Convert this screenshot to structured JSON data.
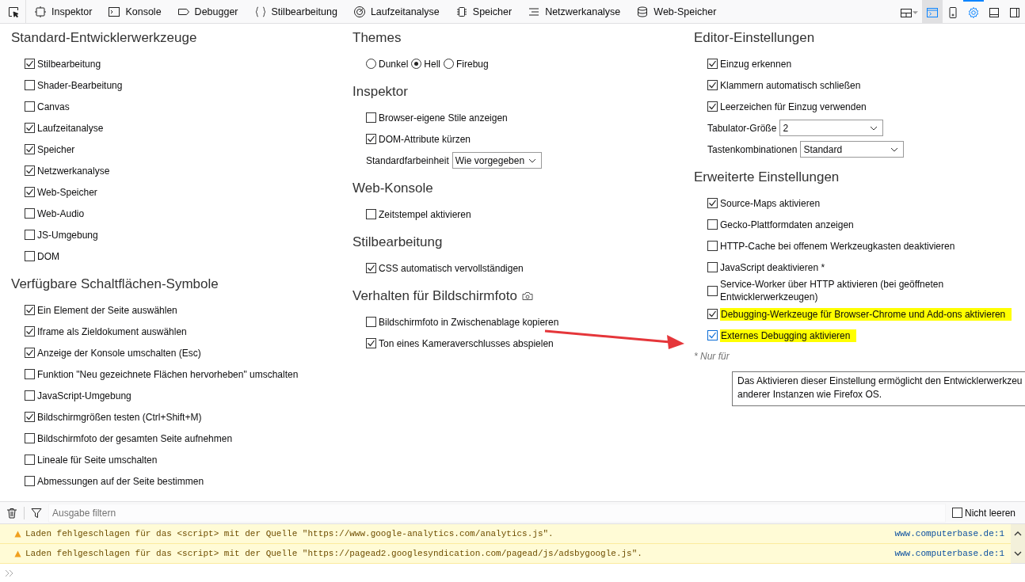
{
  "toolbar": {
    "tabs": [
      {
        "label": "Inspektor",
        "selected": false
      },
      {
        "label": "Konsole",
        "selected": false
      },
      {
        "label": "Debugger",
        "selected": false
      },
      {
        "label": "Stilbearbeitung",
        "selected": false
      },
      {
        "label": "Laufzeitanalyse",
        "selected": false
      },
      {
        "label": "Speicher",
        "selected": false
      },
      {
        "label": "Netzwerkanalyse",
        "selected": false
      },
      {
        "label": "Web-Speicher",
        "selected": false
      }
    ],
    "right_buttons": [
      {
        "selected": false
      },
      {
        "selected": true
      },
      {
        "selected": false
      },
      {
        "selected": true
      },
      {
        "selected": false
      },
      {
        "selected": false
      }
    ]
  },
  "columns": [
    [
      {
        "title": "Standard-Entwicklerwerkzeuge",
        "items": [
          {
            "kind": "checkbox",
            "label": "Stilbearbeitung",
            "checked": true
          },
          {
            "kind": "checkbox",
            "label": "Shader-Bearbeitung",
            "checked": false
          },
          {
            "kind": "checkbox",
            "label": "Canvas",
            "checked": false
          },
          {
            "kind": "checkbox",
            "label": "Laufzeitanalyse",
            "checked": true
          },
          {
            "kind": "checkbox",
            "label": "Speicher",
            "checked": true
          },
          {
            "kind": "checkbox",
            "label": "Netzwerkanalyse",
            "checked": true
          },
          {
            "kind": "checkbox",
            "label": "Web-Speicher",
            "checked": true
          },
          {
            "kind": "checkbox",
            "label": "Web-Audio",
            "checked": false
          },
          {
            "kind": "checkbox",
            "label": "JS-Umgebung",
            "checked": false
          },
          {
            "kind": "checkbox",
            "label": "DOM",
            "checked": false
          }
        ]
      },
      {
        "title": "Verfügbare Schaltflächen-Symbole",
        "items": [
          {
            "kind": "checkbox",
            "label": "Ein Element der Seite auswählen",
            "checked": true
          },
          {
            "kind": "checkbox",
            "label": "Iframe als Zieldokument auswählen",
            "checked": true
          },
          {
            "kind": "checkbox",
            "label": "Anzeige der Konsole umschalten (Esc)",
            "checked": true
          },
          {
            "kind": "checkbox",
            "label": "Funktion \"Neu gezeichnete Flächen hervorheben\" umschalten",
            "checked": false
          },
          {
            "kind": "checkbox",
            "label": "JavaScript-Umgebung",
            "checked": false
          },
          {
            "kind": "checkbox",
            "label": "Bildschirmgrößen testen (Ctrl+Shift+M)",
            "checked": true
          },
          {
            "kind": "checkbox",
            "label": "Bildschirmfoto der gesamten Seite aufnehmen",
            "checked": false
          },
          {
            "kind": "checkbox",
            "label": "Lineale für Seite umschalten",
            "checked": false
          },
          {
            "kind": "checkbox",
            "label": "Abmessungen auf der Seite bestimmen",
            "checked": false
          }
        ]
      }
    ],
    [
      {
        "title": "Themes",
        "items": [
          {
            "kind": "radios",
            "options": [
              {
                "label": "Dunkel",
                "selected": false
              },
              {
                "label": "Hell",
                "selected": true
              },
              {
                "label": "Firebug",
                "selected": false
              }
            ]
          }
        ]
      },
      {
        "title": "Inspektor",
        "items": [
          {
            "kind": "checkbox",
            "label": "Browser-eigene Stile anzeigen",
            "checked": false
          },
          {
            "kind": "checkbox",
            "label": "DOM-Attribute kürzen",
            "checked": true
          },
          {
            "kind": "select",
            "label": "Standardfarbeinheit",
            "value": "Wie vorgegeben"
          }
        ]
      },
      {
        "title": "Web-Konsole",
        "items": [
          {
            "kind": "checkbox",
            "label": "Zeitstempel aktivieren",
            "checked": false
          }
        ]
      },
      {
        "title": "Stilbearbeitung",
        "items": [
          {
            "kind": "checkbox",
            "label": "CSS automatisch vervollständigen",
            "checked": true
          }
        ]
      },
      {
        "title": "Verhalten für Bildschirmfoto",
        "camera": true,
        "items": [
          {
            "kind": "checkbox",
            "label": "Bildschirmfoto in Zwischenablage kopieren",
            "checked": false
          },
          {
            "kind": "checkbox",
            "label": "Ton eines Kameraverschlusses abspielen",
            "checked": true
          }
        ]
      }
    ],
    [
      {
        "title": "Editor-Einstellungen",
        "items": [
          {
            "kind": "checkbox",
            "label": "Einzug erkennen",
            "checked": true
          },
          {
            "kind": "checkbox",
            "label": "Klammern automatisch schließen",
            "checked": true
          },
          {
            "kind": "checkbox",
            "label": "Leerzeichen für Einzug verwenden",
            "checked": true
          },
          {
            "kind": "select",
            "label": "Tabulator-Größe",
            "value": "2"
          },
          {
            "kind": "select",
            "label": "Tastenkombinationen",
            "value": "Standard"
          }
        ]
      },
      {
        "title": "Erweiterte Einstellungen",
        "items": [
          {
            "kind": "checkbox",
            "label": "Source-Maps aktivieren",
            "checked": true
          },
          {
            "kind": "checkbox",
            "label": "Gecko-Plattformdaten anzeigen",
            "checked": false
          },
          {
            "kind": "checkbox",
            "label": "HTTP-Cache bei offenem Werkzeugkasten deaktivieren",
            "checked": false
          },
          {
            "kind": "checkbox",
            "label": "JavaScript deaktivieren *",
            "checked": false
          },
          {
            "kind": "checkbox",
            "label": "Service-Worker über HTTP aktivieren (bei geöffneten Entwicklerwerkzeugen)",
            "checked": false
          },
          {
            "kind": "checkbox",
            "label": "Debugging-Werkzeuge für Browser-Chrome und Add-ons aktivieren",
            "checked": true,
            "highlighted": true
          },
          {
            "kind": "checkbox",
            "label": "Externes Debugging aktivieren",
            "checked": true,
            "highlighted": true,
            "focused": true
          }
        ],
        "footnote": "* Nur für"
      }
    ]
  ],
  "tooltip": [
    "Das Aktivieren dieser Einstellung ermöglicht den Entwicklerwerkzeu",
    "anderer Instanzen wie Firefox OS."
  ],
  "console": {
    "filter": {
      "placeholder": "Ausgabe filtern"
    },
    "persist": {
      "label": "Nicht leeren",
      "checked": false
    },
    "messages": [
      {
        "text": "Laden fehlgeschlagen für das <script> mit der Quelle \"https://www.google-analytics.com/analytics.js\".",
        "source": "www.computerbase.de:1"
      },
      {
        "text": "Laden fehlgeschlagen für das <script> mit der Quelle \"https://pagead2.googlesyndication.com/pagead/js/adsbygoogle.js\".",
        "source": "www.computerbase.de:1"
      }
    ]
  }
}
